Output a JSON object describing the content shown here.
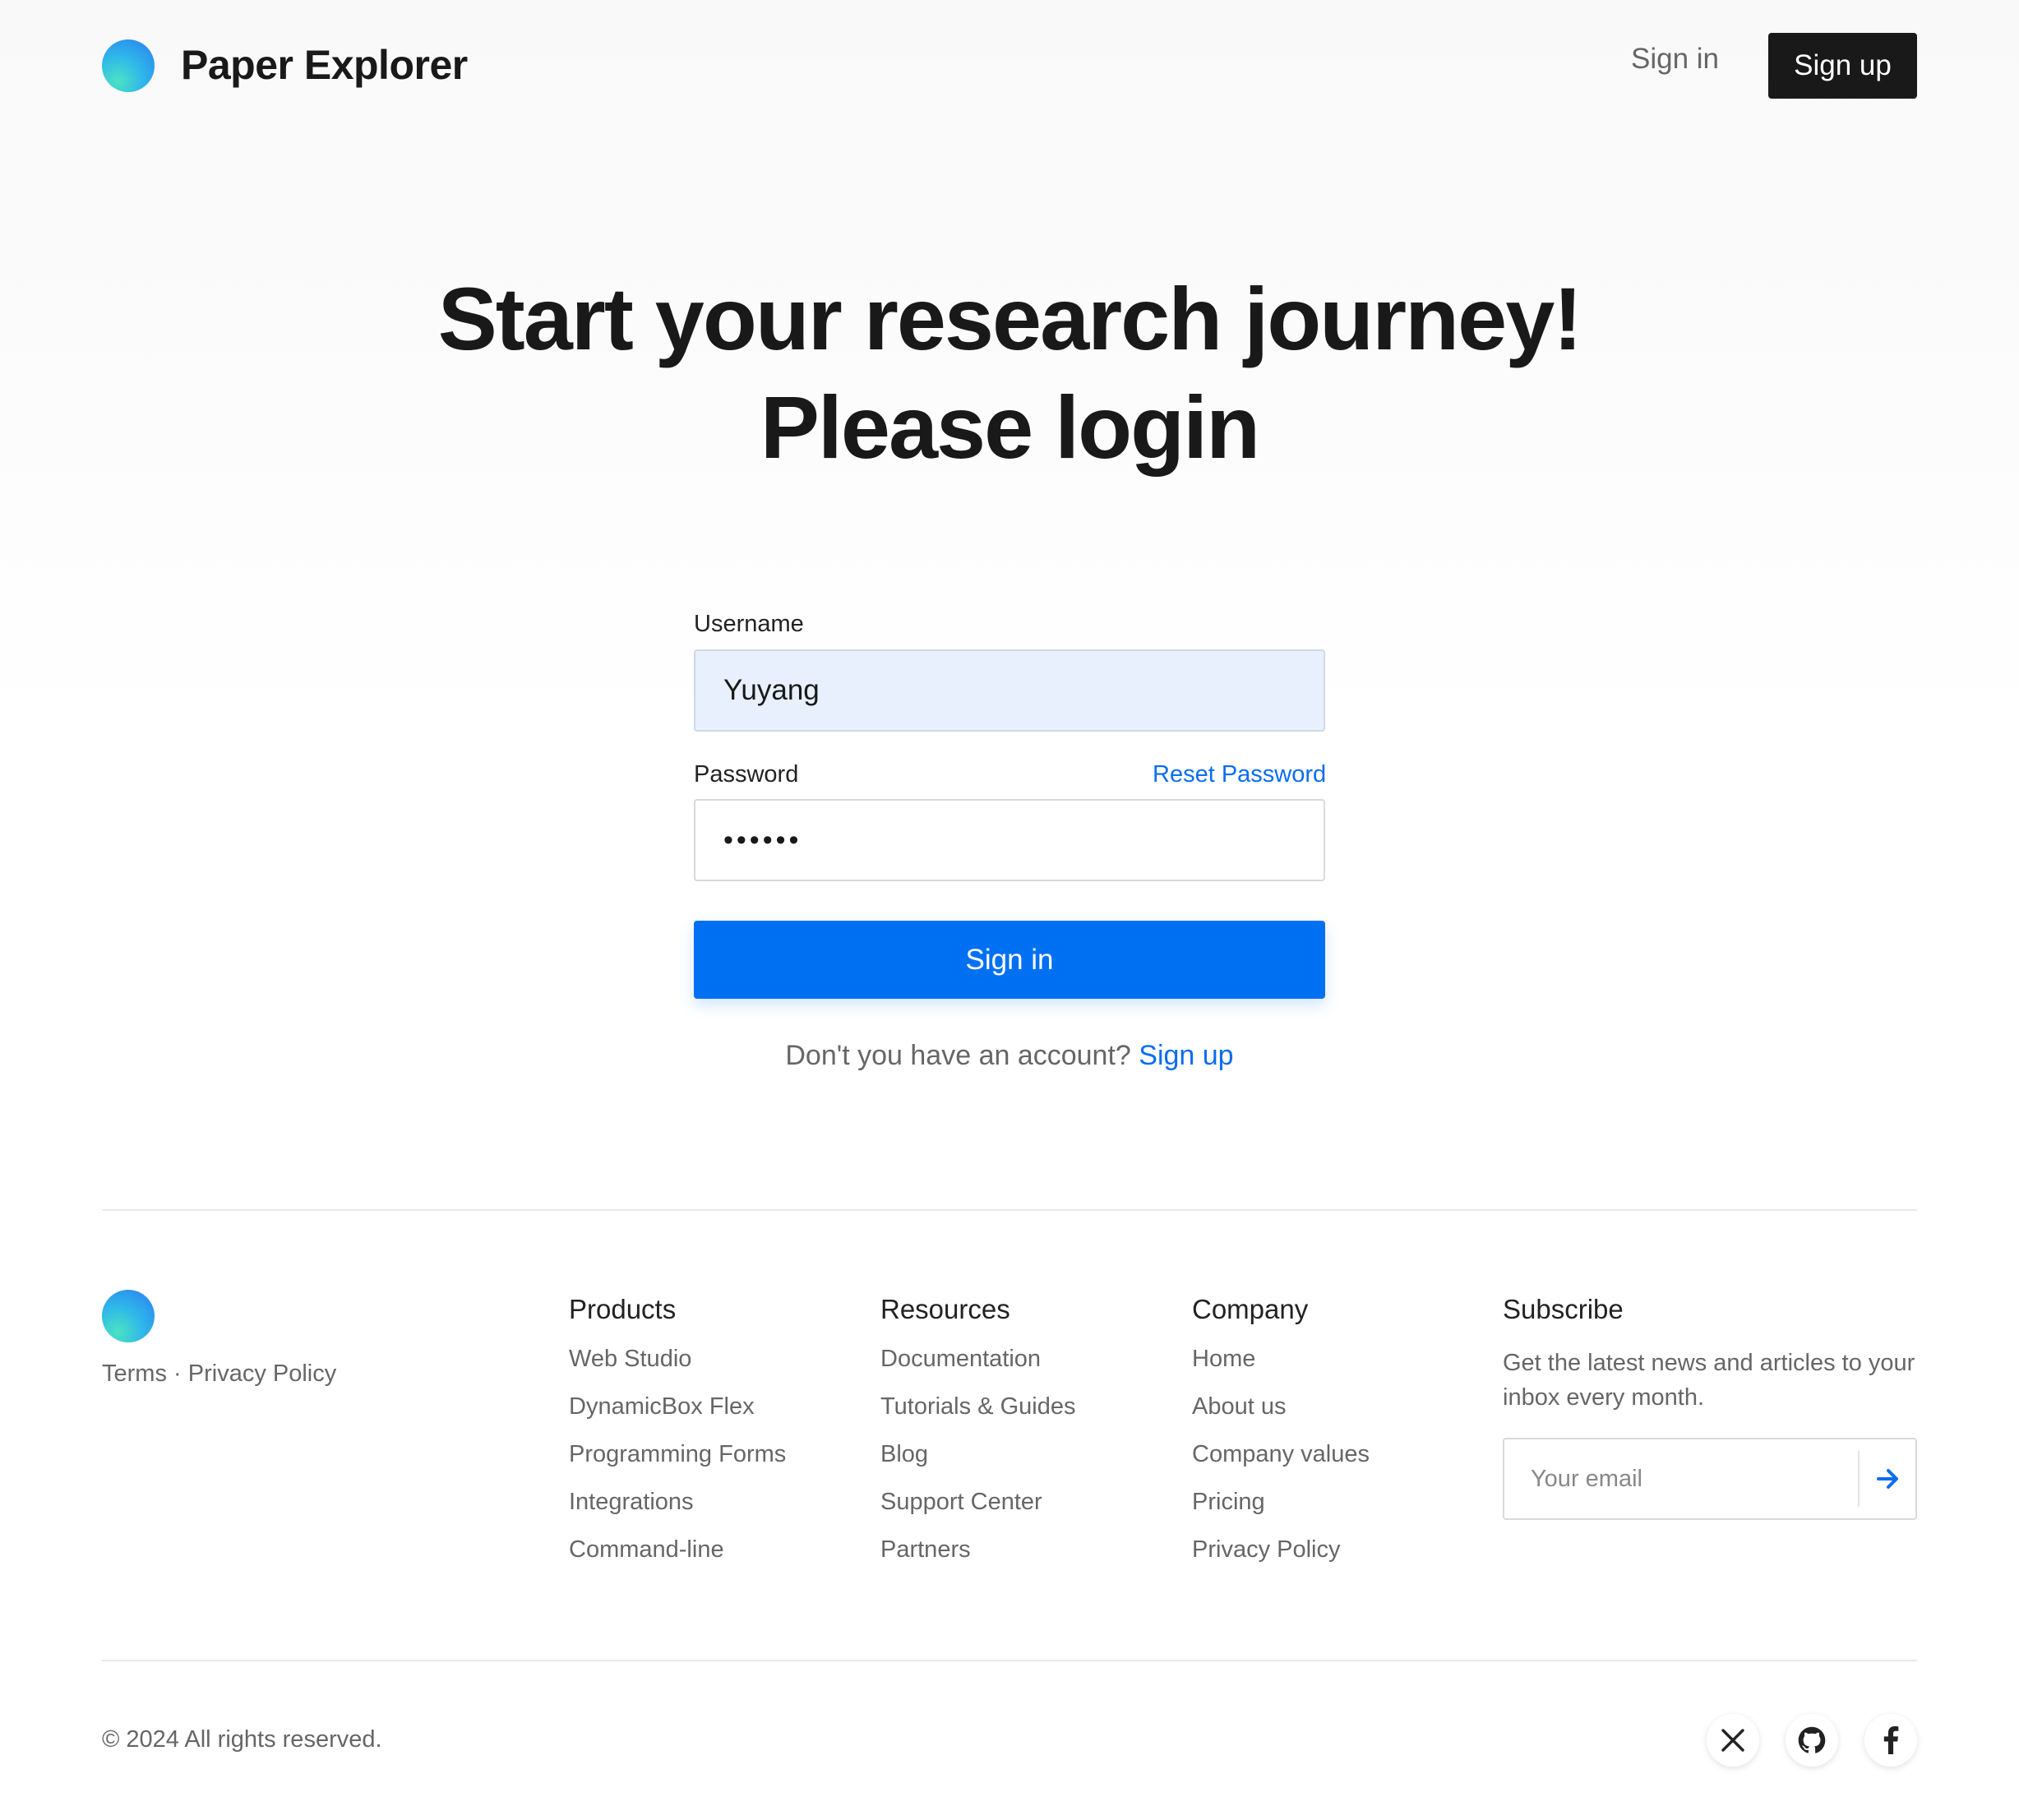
{
  "header": {
    "brand": "Paper Explorer",
    "sign_in": "Sign in",
    "sign_up": "Sign up"
  },
  "hero": {
    "line1": "Start your research journey!",
    "line2": "Please login"
  },
  "form": {
    "username_label": "Username",
    "username_value": "Yuyang",
    "password_label": "Password",
    "password_mask": "••••••",
    "reset_password": "Reset Password",
    "submit": "Sign in",
    "no_account_text": "Don't you have an account?",
    "no_account_link": "Sign up"
  },
  "footer": {
    "legal": {
      "terms": "Terms",
      "separator": "·",
      "privacy": "Privacy Policy"
    },
    "columns": [
      {
        "title": "Products",
        "links": [
          "Web Studio",
          "DynamicBox Flex",
          "Programming Forms",
          "Integrations",
          "Command-line"
        ]
      },
      {
        "title": "Resources",
        "links": [
          "Documentation",
          "Tutorials & Guides",
          "Blog",
          "Support Center",
          "Partners"
        ]
      },
      {
        "title": "Company",
        "links": [
          "Home",
          "About us",
          "Company values",
          "Pricing",
          "Privacy Policy"
        ]
      }
    ],
    "subscribe": {
      "title": "Subscribe",
      "text": "Get the latest news and articles to your inbox every month.",
      "placeholder": "Your email",
      "button_icon": "arrow-right-icon"
    },
    "copyright": "© 2024 All rights reserved.",
    "social_icons": [
      "x-icon",
      "github-icon",
      "facebook-icon"
    ]
  },
  "colors": {
    "accent": "#0070f3",
    "link": "#0a6df0",
    "dark_button": "#191919",
    "username_field_bg": "#e8f0fe"
  }
}
